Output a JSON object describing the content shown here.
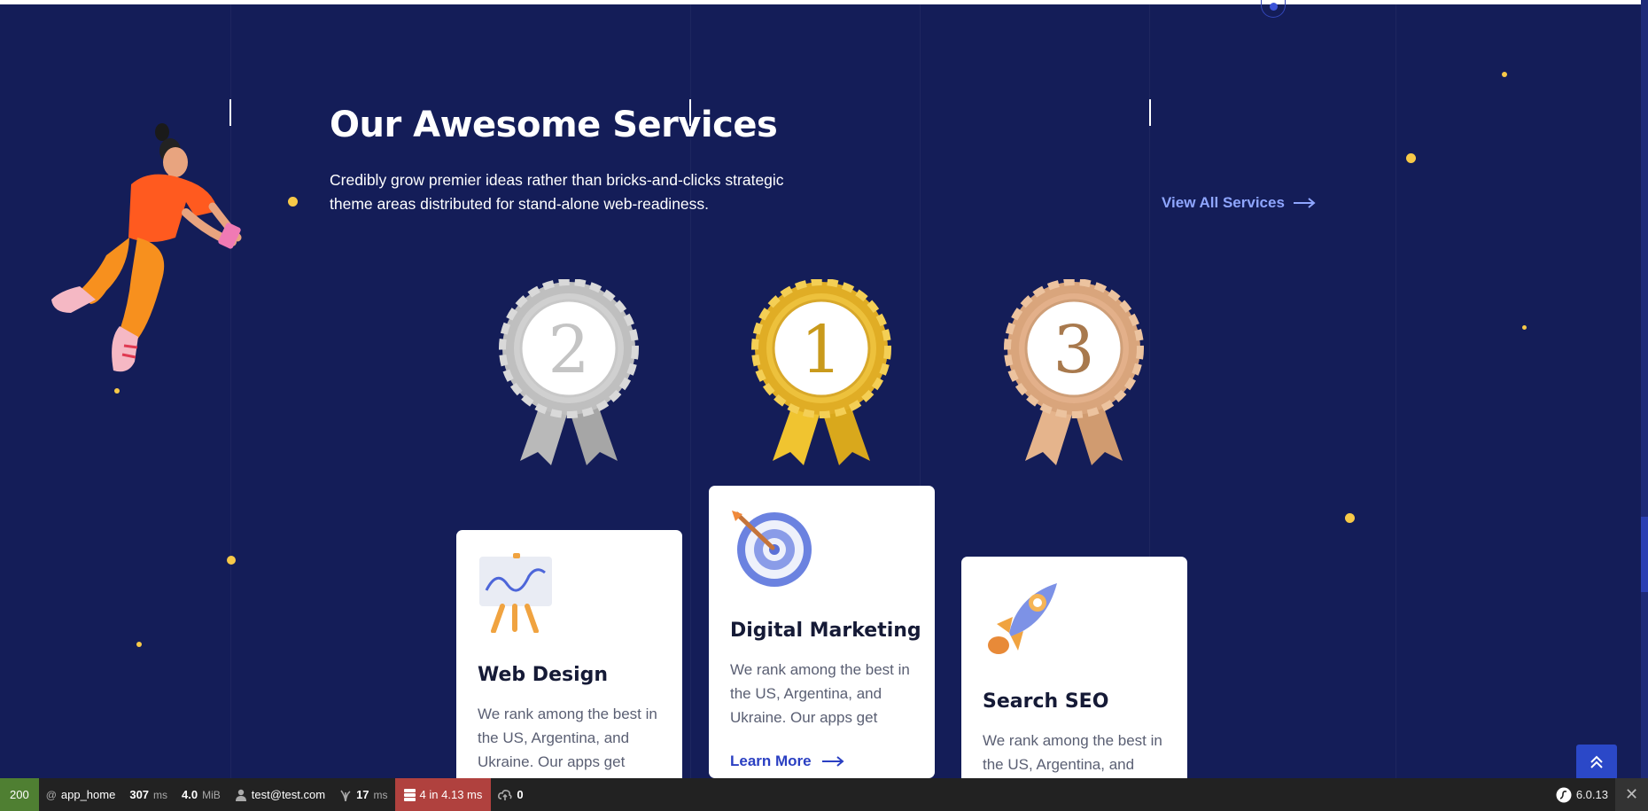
{
  "section": {
    "title": "Our Awesome Services",
    "subtitle": "Credibly grow premier ideas rather than bricks-and-clicks strategic theme areas distributed for stand-alone web-readiness.",
    "view_all_label": "View All Services"
  },
  "medals": [
    {
      "rank": "2",
      "tier": "silver",
      "icon": "silver-medal-icon"
    },
    {
      "rank": "1",
      "tier": "gold",
      "icon": "gold-medal-icon"
    },
    {
      "rank": "3",
      "tier": "bronze",
      "icon": "bronze-medal-icon"
    }
  ],
  "cards": [
    {
      "title": "Web Design",
      "text": "We rank among the best in the US, Argentina, and Ukraine. Our apps get",
      "icon": "presentation-board-icon"
    },
    {
      "title": "Digital Marketing",
      "text": "We rank among the best in the US, Argentina, and Ukraine. Our apps get",
      "learn_more": "Learn More",
      "icon": "target-arrow-icon"
    },
    {
      "title": "Search SEO",
      "text": "We rank among the best in the US, Argentina, and Ukraine. Our apps get",
      "icon": "rocket-icon"
    }
  ],
  "toolbar": {
    "status": "200",
    "route": "app_home",
    "time_value": "307",
    "time_unit": "ms",
    "memory_value": "4.0",
    "memory_unit": "MiB",
    "user": "test@test.com",
    "twig_value": "17",
    "twig_unit": "ms",
    "db": "4 in 4.13 ms",
    "cache_count": "0",
    "version": "6.0.13"
  },
  "colors": {
    "background": "#141d58",
    "accent": "#2a3fc2",
    "link": "#8fa6ff",
    "dot": "#f7c948"
  }
}
